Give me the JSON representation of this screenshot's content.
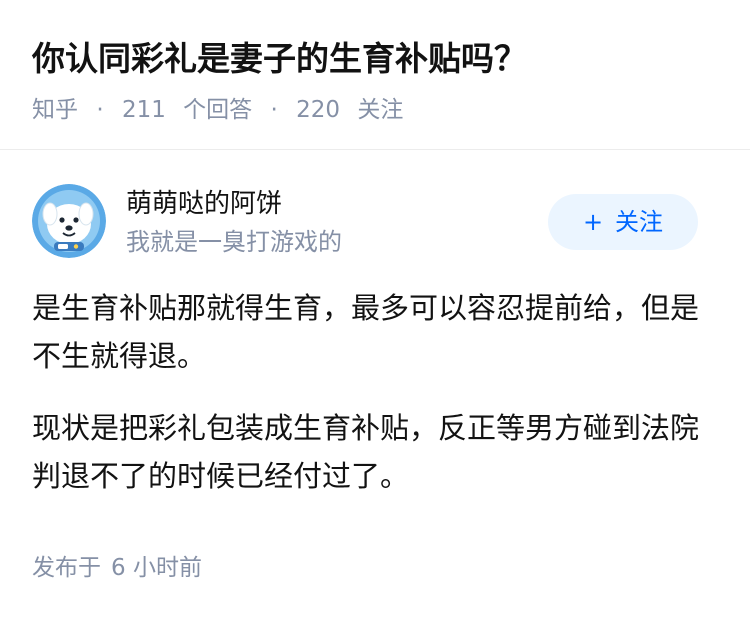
{
  "question": {
    "title": "你认同彩礼是妻子的生育补贴吗？",
    "source": "知乎",
    "separator": "·",
    "answer_count": "211",
    "answer_label": "个回答",
    "follower_count": "220",
    "follower_label": "关注"
  },
  "author": {
    "name": "萌萌哒的阿饼",
    "bio": "我就是一臭打游戏的",
    "avatar_icon": "cartoon-dog-astronaut-avatar",
    "follow_plus": "+",
    "follow_label": "关注"
  },
  "answer": {
    "paragraphs": [
      "是生育补贴那就得生育，最多可以容忍提前给，但是不生就得退。",
      "现状是把彩礼包装成生育补贴，反正等男方碰到法院判退不了的时候已经付过了。"
    ],
    "published_label": "发布于",
    "published_time": "6 小时前"
  },
  "colors": {
    "primary": "#0066ff",
    "follow_bg": "#ebf5ff",
    "meta_gray": "#8590a6",
    "text": "#121212"
  }
}
